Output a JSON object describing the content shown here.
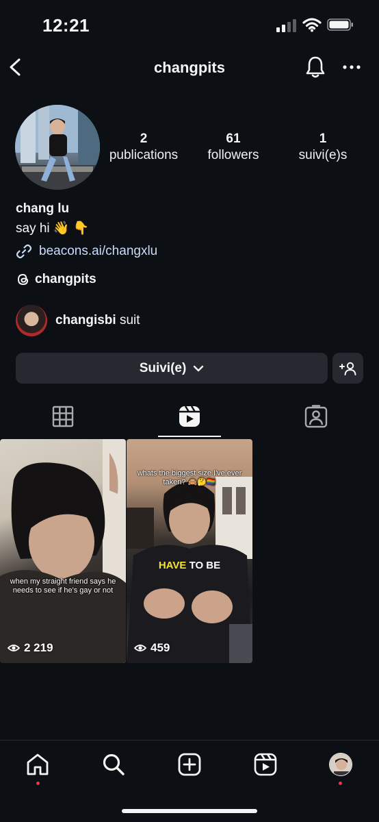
{
  "status_bar": {
    "time": "12:21"
  },
  "header": {
    "title": "changpits"
  },
  "profile": {
    "stats": [
      {
        "value": "2",
        "label": "publications"
      },
      {
        "value": "61",
        "label": "followers"
      },
      {
        "value": "1",
        "label": "suivi(e)s"
      }
    ],
    "name": "chang lu",
    "bio": "say hi 👋 👇",
    "link": "beacons.ai/changxlu",
    "threads_handle": "changpits",
    "followed_by": {
      "user": "changisbi",
      "suffix": " suit"
    }
  },
  "actions": {
    "follow_label": "Suivi(e)"
  },
  "reels": [
    {
      "caption": "when my straight friend says he needs to see if he's gay or not",
      "views": "2 219"
    },
    {
      "caption": "whats the biggest size I've ever taken? 🙈🤔🏳️‍🌈",
      "overlay_highlight": "HAVE",
      "overlay_rest": " TO BE",
      "views": "459"
    }
  ],
  "colors": {
    "background": "#0c1014",
    "button": "#262a30",
    "link": "#c9dcfb",
    "notification_dot": "#ff3040"
  }
}
